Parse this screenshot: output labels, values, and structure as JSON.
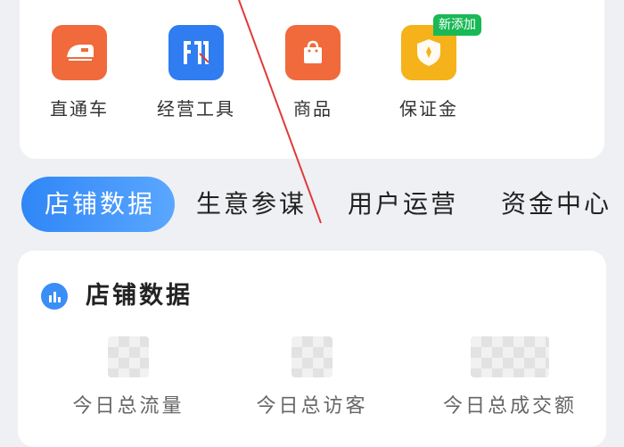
{
  "tools": [
    {
      "label": "直通车",
      "icon": "train-icon",
      "color": "#f06a3c"
    },
    {
      "label": "经营工具",
      "icon": "stats-icon",
      "color": "#2f7df0"
    },
    {
      "label": "商品",
      "icon": "shopping-bag-icon",
      "color": "#f06a3c"
    },
    {
      "label": "保证金",
      "icon": "shield-icon",
      "color": "#f5b21a",
      "badge": "新添加"
    }
  ],
  "tabs": [
    {
      "label": "店铺数据",
      "active": true
    },
    {
      "label": "生意参谋"
    },
    {
      "label": "用户运营"
    },
    {
      "label": "资金中心"
    }
  ],
  "store_data": {
    "title": "店铺数据",
    "metrics": [
      {
        "label": "今日总流量"
      },
      {
        "label": "今日总访客"
      },
      {
        "label": "今日总成交额"
      }
    ]
  },
  "colors": {
    "accent": "#2f86f6",
    "badge": "#19b955",
    "annotation": "#e23a3a"
  }
}
